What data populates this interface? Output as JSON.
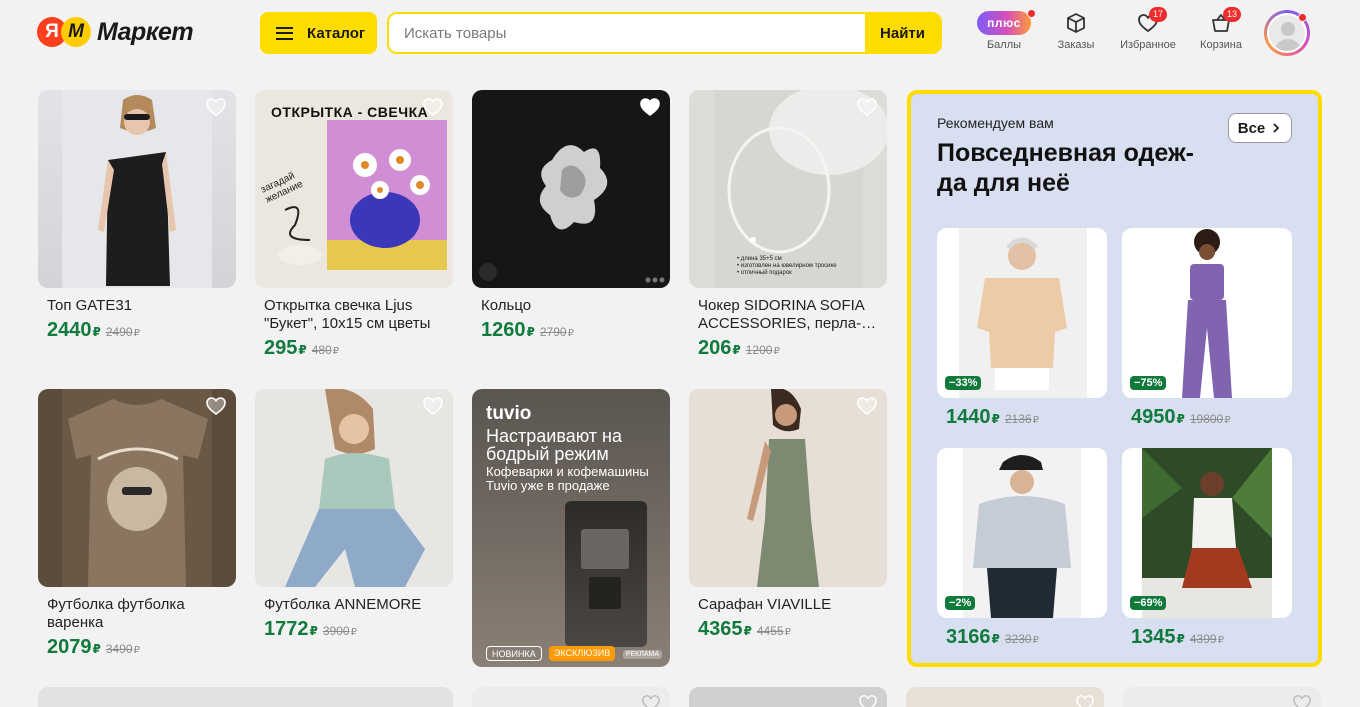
{
  "header": {
    "logo_ya": "Я",
    "logo_m": "М",
    "logo_text": "Маркет",
    "catalog_label": "Каталог",
    "search_placeholder": "Искать товары",
    "search_button": "Найти",
    "plus_badge": "плюс",
    "points_label": "Баллы",
    "orders_label": "Заказы",
    "favorites_label": "Избранное",
    "favorites_count": "17",
    "cart_label": "Корзина",
    "cart_count": "13"
  },
  "products": [
    {
      "title": "Топ GATE31",
      "price": "2440",
      "currency": "₽",
      "old_price": "2490"
    },
    {
      "title": "Открытка свечка Ljus \"Букет\", 10x15 см цветы",
      "price": "295",
      "currency": "₽",
      "old_price": "480",
      "image_text": "ОТКРЫТКА - СВЕЧКА",
      "image_text_2": "загадай желание"
    },
    {
      "title": "Кольцо",
      "price": "1260",
      "currency": "₽",
      "old_price": "2790"
    },
    {
      "title": "Чокер SIDORINA SOFIA ACCESSORIES, перла-…",
      "price": "206",
      "currency": "₽",
      "old_price": "1200",
      "image_notes": [
        "• длина 35+5 см",
        "• изготовлен на ювелирном тросике",
        "• отличный подарок"
      ]
    },
    {
      "title": "Футболка футболка варенка",
      "price": "2079",
      "currency": "₽",
      "old_price": "3490"
    },
    {
      "title": "Футболка ANNEMORE",
      "price": "1772",
      "currency": "₽",
      "old_price": "3900"
    },
    {
      "title": "Сарафан VIAVILLE",
      "price": "4365",
      "currency": "₽",
      "old_price": "4455"
    }
  ],
  "promo": {
    "brand": "tuvio",
    "headline": "Настраивают на бодрый режим",
    "subtitle": "Кофеварки и кофемашины Tuvio уже в продаже",
    "tag_new": "НОВИНКА",
    "tag_exclusive": "ЭКСКЛЮЗИВ",
    "tag_ad": "РЕКЛАМА"
  },
  "recommendations": {
    "eyebrow": "Рекомендуем вам",
    "title": "Повседневная одеж-да для неё",
    "all_button": "Все",
    "items": [
      {
        "discount": "−33%",
        "price": "1440",
        "currency": "₽",
        "old_price": "2136"
      },
      {
        "discount": "−75%",
        "price": "4950",
        "currency": "₽",
        "old_price": "19800"
      },
      {
        "discount": "−2%",
        "price": "3166",
        "currency": "₽",
        "old_price": "3230"
      },
      {
        "discount": "−69%",
        "price": "1345",
        "currency": "₽",
        "old_price": "4399"
      }
    ]
  },
  "colors": {
    "brand_yellow": "#ffdc00",
    "price_green": "#117a3d",
    "badge_red": "#f02b2b",
    "rec_bg": "#d7dff0"
  }
}
